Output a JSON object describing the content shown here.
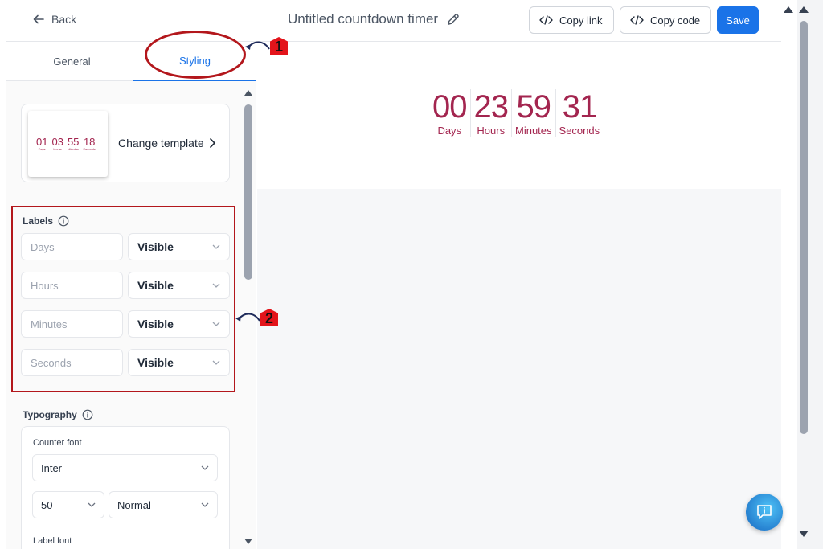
{
  "header": {
    "back_label": "Back",
    "title": "Untitled countdown timer",
    "copy_link_label": "Copy link",
    "copy_code_label": "Copy code",
    "save_label": "Save"
  },
  "tabs": [
    {
      "label": "General",
      "active": false
    },
    {
      "label": "Styling",
      "active": true
    }
  ],
  "template": {
    "change_label": "Change template",
    "thumb_units": [
      {
        "num": "01",
        "label": "Days"
      },
      {
        "num": "03",
        "label": "Hours"
      },
      {
        "num": "55",
        "label": "Minutes"
      },
      {
        "num": "18",
        "label": "Seconds"
      }
    ]
  },
  "labels_section": {
    "title": "Labels",
    "rows": [
      {
        "placeholder": "Days",
        "visibility": "Visible"
      },
      {
        "placeholder": "Hours",
        "visibility": "Visible"
      },
      {
        "placeholder": "Minutes",
        "visibility": "Visible"
      },
      {
        "placeholder": "Seconds",
        "visibility": "Visible"
      }
    ]
  },
  "typography": {
    "title": "Typography",
    "counter_font_label": "Counter font",
    "counter_font": "Inter",
    "counter_size": "50",
    "counter_weight": "Normal",
    "label_font_label": "Label font"
  },
  "preview": {
    "units": [
      {
        "num": "00",
        "label": "Days"
      },
      {
        "num": "23",
        "label": "Hours"
      },
      {
        "num": "59",
        "label": "Minutes"
      },
      {
        "num": "31",
        "label": "Seconds"
      }
    ],
    "accent_color": "#a3254f"
  },
  "annotations": {
    "badge_1": "1",
    "badge_2": "2"
  },
  "colors": {
    "primary": "#1a73e8",
    "annotation": "#b3171c"
  }
}
